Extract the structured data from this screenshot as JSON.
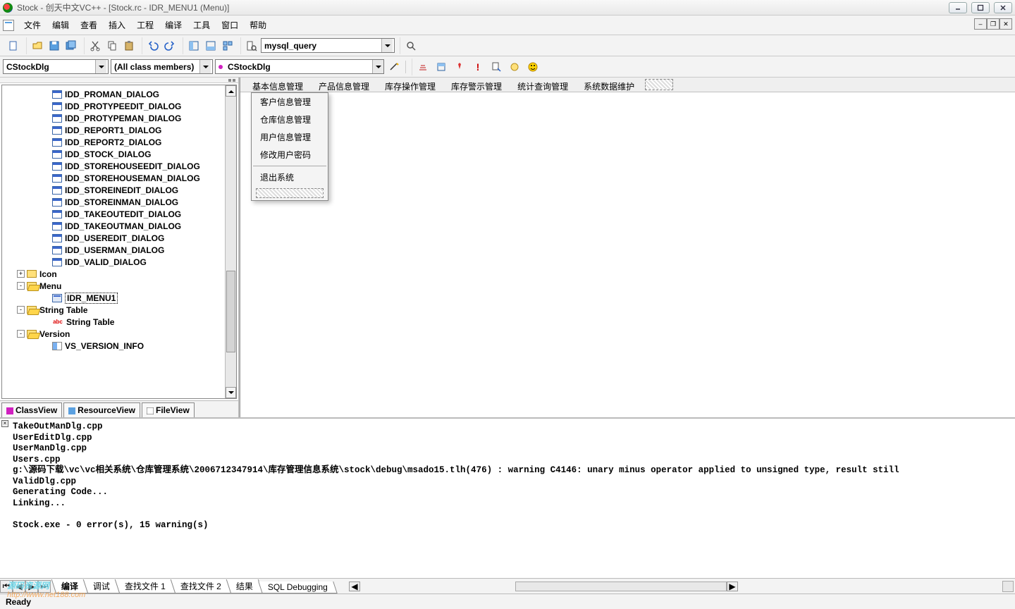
{
  "title": "Stock - 创天中文VC++ - [Stock.rc - IDR_MENU1 (Menu)]",
  "menus": {
    "items": [
      "文件",
      "编辑",
      "查看",
      "插入",
      "工程",
      "编译",
      "工具",
      "窗口",
      "帮助"
    ]
  },
  "toolbar1": {
    "search_value": "mysql_query"
  },
  "toolbar2": {
    "combo1": "CStockDlg",
    "combo2": "(All class members)",
    "combo3": "CStockDlg"
  },
  "tree": {
    "dialogs": [
      "IDD_PROMAN_DIALOG",
      "IDD_PROTYPEEDIT_DIALOG",
      "IDD_PROTYPEMAN_DIALOG",
      "IDD_REPORT1_DIALOG",
      "IDD_REPORT2_DIALOG",
      "IDD_STOCK_DIALOG",
      "IDD_STOREHOUSEEDIT_DIALOG",
      "IDD_STOREHOUSEMAN_DIALOG",
      "IDD_STOREINEDIT_DIALOG",
      "IDD_STOREINMAN_DIALOG",
      "IDD_TAKEOUTEDIT_DIALOG",
      "IDD_TAKEOUTMAN_DIALOG",
      "IDD_USEREDIT_DIALOG",
      "IDD_USERMAN_DIALOG",
      "IDD_VALID_DIALOG"
    ],
    "icon_folder": "Icon",
    "menu_folder": "Menu",
    "menu_item": "IDR_MENU1",
    "string_folder": "String Table",
    "string_item": "String Table",
    "version_folder": "Version",
    "version_item": "VS_VERSION_INFO"
  },
  "left_tabs": {
    "items": [
      "ClassView",
      "ResourceView",
      "FileView"
    ]
  },
  "menu_editor": {
    "items": [
      "基本信息管理",
      "产品信息管理",
      "库存操作管理",
      "库存警示管理",
      "统计查询管理",
      "系统数据维护"
    ],
    "dropdown": [
      "客户信息管理",
      "仓库信息管理",
      "用户信息管理",
      "修改用户密码"
    ],
    "dropdown_tail": "退出系统"
  },
  "output": {
    "lines": [
      "TakeOutManDlg.cpp",
      "UserEditDlg.cpp",
      "UserManDlg.cpp",
      "Users.cpp",
      "g:\\源码下载\\vc\\vc相关系统\\仓库管理系统\\2006712347914\\库存管理信息系统\\stock\\debug\\msado15.tlh(476) : warning C4146: unary minus operator applied to unsigned type, result still",
      "ValidDlg.cpp",
      "Generating Code...",
      "Linking...",
      "",
      "Stock.exe - 0 error(s), 15 warning(s)"
    ],
    "tabs": [
      "编译",
      "调试",
      "查找文件 1",
      "查找文件 2",
      "结果",
      "SQL Debugging"
    ]
  },
  "status": {
    "text": "Ready"
  },
  "watermark": {
    "main": "源码资源网",
    "sub": "http://www.net188.com"
  }
}
